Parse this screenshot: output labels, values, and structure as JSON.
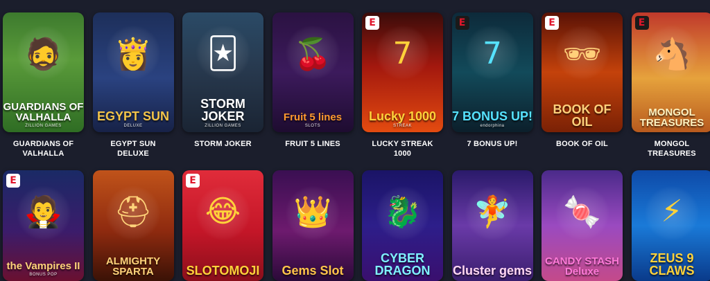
{
  "games": [
    {
      "name": "GUARDIANS OF VALHALLA",
      "art": "GUARDIANS OF VALHALLA",
      "art_sub": "ZILLION GAMES",
      "provider": "",
      "bg": "linear-gradient(180deg,#3d7a2e 0%,#5a9b3a 40%,#2f6d24 100%)",
      "art_color": "#ffffff",
      "icon": "viking-icon",
      "glyph": "🧔"
    },
    {
      "name": "EGYPT SUN DELUXE",
      "art": "EGYPT SUN",
      "art_sub": "DELUXE",
      "provider": "",
      "bg": "linear-gradient(180deg,#1d2f5a 0%,#2a4280 55%,#172247 100%)",
      "art_color": "#f3c44a",
      "icon": "pharaoh-queen-icon",
      "glyph": "👸"
    },
    {
      "name": "STORM JOKER",
      "art": "STORM JOKER",
      "art_sub": "ZILLION GAMES",
      "provider": "",
      "bg": "linear-gradient(180deg,#2a4a66 0%,#27384d 50%,#1a2433 100%)",
      "art_color": "#ffffff",
      "icon": "joker-icon",
      "glyph": "🃏"
    },
    {
      "name": "FRUIT 5 LINES",
      "art": "Fruit 5 lines",
      "art_sub": "SLOTS",
      "provider": "",
      "bg": "linear-gradient(180deg,#2b1242 0%,#3c1a5c 50%,#1e0c30 100%)",
      "art_color": "#ff9a2e",
      "icon": "fruit-icon",
      "glyph": "🍒"
    },
    {
      "name": "LUCKY STREAK 1000",
      "art": "Lucky 1000",
      "art_sub": "STREAK",
      "provider": "E",
      "bg": "linear-gradient(180deg,#3a0c0a 0%,#a3180e 45%,#e34b10 100%)",
      "art_color": "#ffd23a",
      "icon": "seven-icon",
      "glyph": "7"
    },
    {
      "name": "7 BONUS UP!",
      "art": "7 BONUS UP!",
      "art_sub": "endorphina",
      "provider": "E",
      "bg": "linear-gradient(180deg,#0d2a3a 0%,#124a5a 50%,#0c1f2b 100%)",
      "art_color": "#56e2ff",
      "icon": "bonus-icon",
      "glyph": "7"
    },
    {
      "name": "BOOK OF OIL",
      "art": "BOOK OF OIL",
      "art_sub": "",
      "provider": "E",
      "bg": "linear-gradient(180deg,#5a1206 0%,#c4420b 50%,#7a2105 100%)",
      "art_color": "#ffd07a",
      "icon": "oil-man-icon",
      "glyph": "🕶"
    },
    {
      "name": "MONGOL TREASURES",
      "art": "MONGOL TREASURES",
      "art_sub": "",
      "provider": "E",
      "bg": "linear-gradient(180deg,#c0392b 0%,#e6a23c 55%,#b85a1e 100%)",
      "art_color": "#fff2c0",
      "icon": "horse-icon",
      "glyph": "🐴"
    },
    {
      "name": "",
      "art": "the Vampires II",
      "art_sub": "BONUS POP",
      "provider": "E",
      "bg": "linear-gradient(180deg,#1a2a66 0%,#3b1c6b 55%,#6a1030 100%)",
      "art_color": "#ffd37a",
      "icon": "vampire-icon",
      "glyph": "🧛"
    },
    {
      "name": "",
      "art": "ALMIGHTY SPARTA",
      "art_sub": "",
      "provider": "",
      "bg": "linear-gradient(180deg,#c0531a 0%,#8e2a0f 55%,#3a1206 100%)",
      "art_color": "#ffd37a",
      "icon": "spartan-helmet-icon",
      "glyph": "⛑"
    },
    {
      "name": "",
      "art": "SLOTOMOJI",
      "art_sub": "",
      "provider": "E",
      "bg": "linear-gradient(180deg,#e02c3a 0%,#c41628 55%,#8a0f1b 100%)",
      "art_color": "#ffd23a",
      "icon": "laughing-emoji-icon",
      "glyph": "😂"
    },
    {
      "name": "",
      "art": "Gems Slot",
      "art_sub": "",
      "provider": "",
      "bg": "linear-gradient(180deg,#3a0f52 0%,#6d1a6e 55%,#2a0a38 100%)",
      "art_color": "#ffc54a",
      "icon": "princess-icon",
      "glyph": "👑"
    },
    {
      "name": "",
      "art": "CYBER DRAGON",
      "art_sub": "",
      "provider": "",
      "bg": "linear-gradient(180deg,#1a1466 0%,#2d1e8a 50%,#3a0f6e 100%)",
      "art_color": "#7ff0ff",
      "icon": "dragon-icon",
      "glyph": "🐉"
    },
    {
      "name": "",
      "art": "Cluster gems",
      "art_sub": "",
      "provider": "",
      "bg": "linear-gradient(180deg,#2a1a6a 0%,#6a3aa8 50%,#3a1e6e 100%)",
      "art_color": "#ffd6f3",
      "icon": "fairy-icon",
      "glyph": "🧚"
    },
    {
      "name": "",
      "art": "CANDY STASH Deluxe",
      "art_sub": "",
      "provider": "",
      "bg": "linear-gradient(180deg,#4a2a8a 0%,#9a4ac0 50%,#c44a8a 100%)",
      "art_color": "#ff7ad9",
      "icon": "candy-icon",
      "glyph": "🍬"
    },
    {
      "name": "",
      "art": "ZEUS 9 CLAWS",
      "art_sub": "",
      "provider": "",
      "bg": "linear-gradient(180deg,#0e4aa8 0%,#1a7ad8 50%,#0a3a8a 100%)",
      "art_color": "#ffd23a",
      "icon": "lightning-icon",
      "glyph": "⚡"
    }
  ]
}
